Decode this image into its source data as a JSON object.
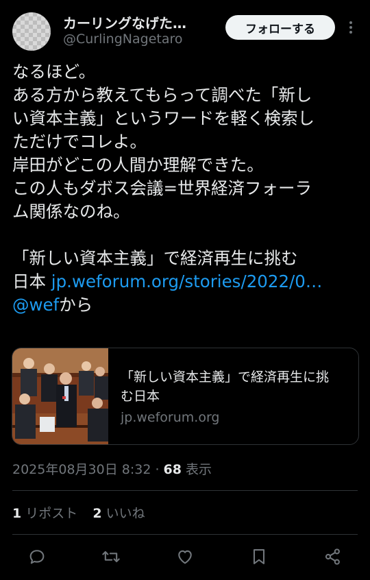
{
  "user": {
    "display_name": "カーリングなげた…",
    "handle": "@CurlingNagetaro"
  },
  "follow_label": "フォローする",
  "tweet": {
    "lines": [
      "なるほど。",
      "ある方から教えてもらって調べた「新し",
      "い資本主義」というワードを軽く検索し",
      "ただけでコレよ。",
      "岸田がどこの人間か理解できた。",
      "この人もダボス会議=世界経済フォーラ",
      "ム関係なのね。",
      "",
      "「新しい資本主義」で経済再生に挑む"
    ],
    "line10_prefix": "日本 ",
    "url_text": "jp.weforum.org/stories/2022/0…",
    "mention": "@wef",
    "mention_suffix": "から"
  },
  "card": {
    "title": "「新しい資本主義」で経済再生に挑む日本",
    "domain": "jp.weforum.org"
  },
  "meta": {
    "datetime": "2025年08月30日 8:32",
    "separator": " · ",
    "views": "68",
    "views_label": " 表示"
  },
  "stats": {
    "reposts_count": "1",
    "reposts_label": "リポスト",
    "likes_count": "2",
    "likes_label": "いいね"
  },
  "icons": [
    "reply-icon",
    "repost-icon",
    "like-icon",
    "bookmark-icon",
    "share-icon"
  ],
  "colors": {
    "background": "#000000",
    "text": "#e7e9ea",
    "secondary": "#71767b",
    "link": "#1d9bf0",
    "follow_bg": "#eff3f4"
  }
}
